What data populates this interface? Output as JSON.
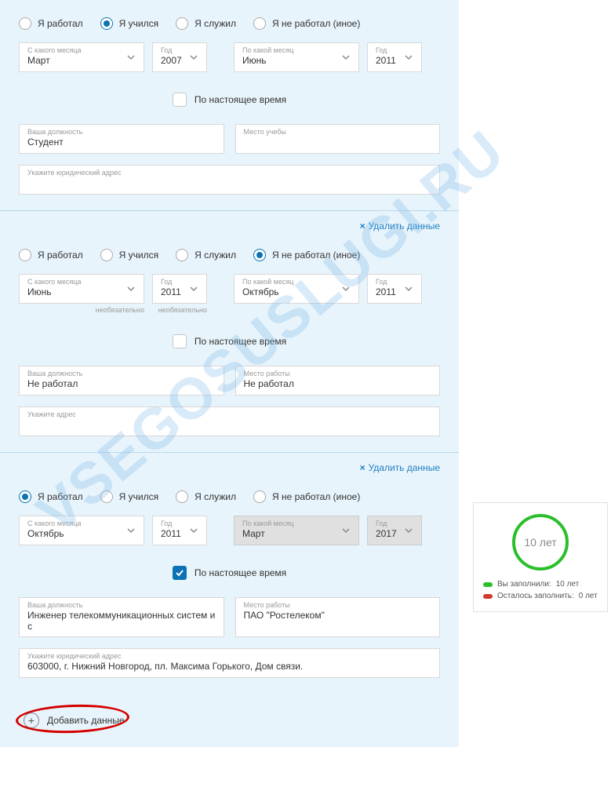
{
  "watermark": "VSEGOSUSLUGI.RU",
  "radios": {
    "worked": "Я работал",
    "studied": "Я учился",
    "served": "Я служил",
    "notWorked": "Я не работал (иное)"
  },
  "labels": {
    "fromMonth": "С какого месяца",
    "toMonth": "По какой месяц",
    "year": "Год",
    "optional": "необязательно",
    "present": "По настоящее время",
    "position": "Ваша должность",
    "studyPlace": "Место учебы",
    "workPlace": "Место работы",
    "legalAddr": "Укажите юридический адрес",
    "addr": "Укажите адрес",
    "delete": "Удалить данные",
    "add": "Добавить данные"
  },
  "sections": [
    {
      "selectedRadio": 1,
      "fromMonth": "Март",
      "fromYear": "2007",
      "toMonth": "Июнь",
      "toYear": "2011",
      "toDisabled": false,
      "showOptional": false,
      "presentChecked": false,
      "position": "Студент",
      "placeLabelKey": "studyPlace",
      "place": "",
      "placeBlurred": true,
      "addrLabelKey": "legalAddr",
      "addr": "",
      "addrBlurred": true,
      "showDelete": false
    },
    {
      "selectedRadio": 3,
      "fromMonth": "Июнь",
      "fromYear": "2011",
      "toMonth": "Октябрь",
      "toYear": "2011",
      "toDisabled": false,
      "showOptional": true,
      "presentChecked": false,
      "position": "Не работал",
      "placeLabelKey": "workPlace",
      "place": "Не работал",
      "placeBlurred": false,
      "addrLabelKey": "addr",
      "addr": "",
      "addrBlurred": true,
      "showDelete": true
    },
    {
      "selectedRadio": 0,
      "fromMonth": "Октябрь",
      "fromYear": "2011",
      "toMonth": "Март",
      "toYear": "2017",
      "toDisabled": true,
      "showOptional": false,
      "presentChecked": true,
      "position": "Инженер телекоммуникационных систем и с",
      "placeLabelKey": "workPlace",
      "place": "ПАО \"Ростелеком\"",
      "placeBlurred": false,
      "addrLabelKey": "legalAddr",
      "addr": "603000, г. Нижний Новгород, пл. Максима Горького, Дом связи.",
      "addrBlurred": false,
      "showDelete": true
    }
  ],
  "widget": {
    "center": "10 лет",
    "filledLabel": "Вы заполнили:",
    "filledValue": "10 лет",
    "remainLabel": "Осталось заполнить:",
    "remainValue": "0 лет"
  }
}
